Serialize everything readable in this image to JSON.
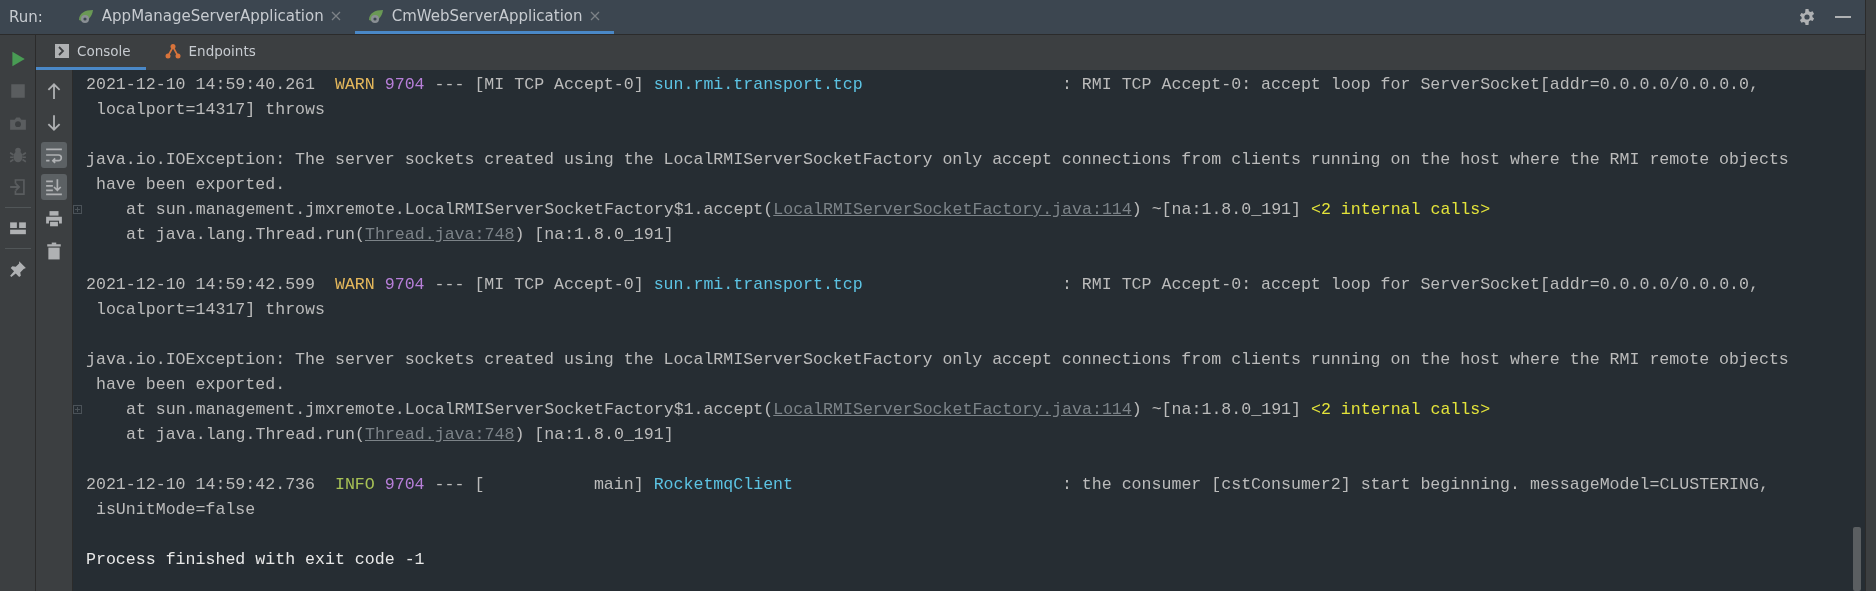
{
  "run_bar": {
    "label": "Run:",
    "tabs": [
      {
        "label": "AppManageServerApplication",
        "selected": false
      },
      {
        "label": "CmWebServerApplication",
        "selected": true
      }
    ]
  },
  "run_toolbar": [
    {
      "disabled": false
    },
    {
      "disabled": true
    },
    {
      "disabled": true
    },
    {
      "disabled": true
    },
    {
      "disabled": true
    },
    {
      "disabled": false
    },
    {
      "disabled": false
    }
  ],
  "console_tabs": [
    {
      "label": "Console",
      "selected": true
    },
    {
      "label": "Endpoints",
      "selected": false
    }
  ],
  "console_toolbar": [
    {
      "on": false
    },
    {
      "on": false
    },
    {
      "on": true
    },
    {
      "on": true
    },
    {
      "on": false
    },
    {
      "on": false
    }
  ],
  "console": {
    "lines": [
      {
        "kind": "text",
        "segments": [
          {
            "kind": "plain",
            "text": "2021-12-10 14:59:40.261  "
          },
          {
            "kind": "warn",
            "text": "WARN "
          },
          {
            "kind": "pid",
            "text": "9704"
          },
          {
            "kind": "plain",
            "text": " --- [MI TCP Accept-0] "
          },
          {
            "kind": "logger",
            "text": "sun.rmi.transport.tcp"
          },
          {
            "kind": "plain",
            "text": "                    : RMI TCP Accept-0: accept loop for ServerSocket[addr=0.0.0.0/0.0.0.0,"
          }
        ]
      },
      {
        "kind": "text",
        "segments": [
          {
            "kind": "plain",
            "text": " localport=14317] throws"
          }
        ]
      },
      {
        "kind": "blank"
      },
      {
        "kind": "text",
        "segments": [
          {
            "kind": "plain",
            "text": "java.io.IOException: The server sockets created using the LocalRMIServerSocketFactory only accept connections from clients running on the host where the RMI remote objects"
          }
        ]
      },
      {
        "kind": "text",
        "segments": [
          {
            "kind": "plain",
            "text": " have been exported."
          }
        ]
      },
      {
        "kind": "stack",
        "fold": true,
        "segments": [
          {
            "kind": "plain",
            "text": "at sun.management.jmxremote.LocalRMIServerSocketFactory$1.accept("
          },
          {
            "kind": "link",
            "text": "LocalRMIServerSocketFactory.java:114"
          },
          {
            "kind": "plain",
            "text": ") ~[na:1.8.0_191] "
          },
          {
            "kind": "hint",
            "text": "<2 internal calls>"
          }
        ]
      },
      {
        "kind": "stack",
        "fold": false,
        "segments": [
          {
            "kind": "plain",
            "text": "at java.lang.Thread.run("
          },
          {
            "kind": "link",
            "text": "Thread.java:748"
          },
          {
            "kind": "plain",
            "text": ") [na:1.8.0_191]"
          }
        ]
      },
      {
        "kind": "blank"
      },
      {
        "kind": "text",
        "segments": [
          {
            "kind": "plain",
            "text": "2021-12-10 14:59:42.599  "
          },
          {
            "kind": "warn",
            "text": "WARN "
          },
          {
            "kind": "pid",
            "text": "9704"
          },
          {
            "kind": "plain",
            "text": " --- [MI TCP Accept-0] "
          },
          {
            "kind": "logger",
            "text": "sun.rmi.transport.tcp"
          },
          {
            "kind": "plain",
            "text": "                    : RMI TCP Accept-0: accept loop for ServerSocket[addr=0.0.0.0/0.0.0.0,"
          }
        ]
      },
      {
        "kind": "text",
        "segments": [
          {
            "kind": "plain",
            "text": " localport=14317] throws"
          }
        ]
      },
      {
        "kind": "blank"
      },
      {
        "kind": "text",
        "segments": [
          {
            "kind": "plain",
            "text": "java.io.IOException: The server sockets created using the LocalRMIServerSocketFactory only accept connections from clients running on the host where the RMI remote objects"
          }
        ]
      },
      {
        "kind": "text",
        "segments": [
          {
            "kind": "plain",
            "text": " have been exported."
          }
        ]
      },
      {
        "kind": "stack",
        "fold": true,
        "segments": [
          {
            "kind": "plain",
            "text": "at sun.management.jmxremote.LocalRMIServerSocketFactory$1.accept("
          },
          {
            "kind": "link",
            "text": "LocalRMIServerSocketFactory.java:114"
          },
          {
            "kind": "plain",
            "text": ") ~[na:1.8.0_191] "
          },
          {
            "kind": "hint",
            "text": "<2 internal calls>"
          }
        ]
      },
      {
        "kind": "stack",
        "fold": false,
        "segments": [
          {
            "kind": "plain",
            "text": "at java.lang.Thread.run("
          },
          {
            "kind": "link",
            "text": "Thread.java:748"
          },
          {
            "kind": "plain",
            "text": ") [na:1.8.0_191]"
          }
        ]
      },
      {
        "kind": "blank"
      },
      {
        "kind": "text",
        "segments": [
          {
            "kind": "plain",
            "text": "2021-12-10 14:59:42.736  "
          },
          {
            "kind": "info",
            "text": "INFO "
          },
          {
            "kind": "pid",
            "text": "9704"
          },
          {
            "kind": "plain",
            "text": " --- [           main] "
          },
          {
            "kind": "logger",
            "text": "RocketmqClient"
          },
          {
            "kind": "plain",
            "text": "                           : the consumer [cstConsumer2] start beginning. messageModel=CLUSTERING,"
          }
        ]
      },
      {
        "kind": "text",
        "segments": [
          {
            "kind": "plain",
            "text": " isUnitMode=false"
          }
        ]
      },
      {
        "kind": "blank"
      },
      {
        "kind": "exit",
        "segments": [
          {
            "kind": "plain",
            "text": "Process finished with exit code -1"
          }
        ]
      }
    ]
  }
}
